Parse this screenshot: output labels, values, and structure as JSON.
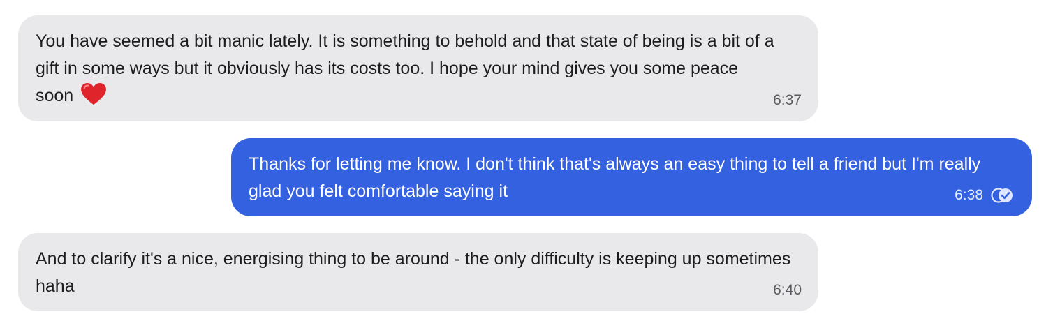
{
  "messages": [
    {
      "direction": "incoming",
      "text": "You have seemed a bit manic lately. It is something to behold and that state of being is a bit of a gift in some ways but it obviously has its costs too. I hope your mind gives you some peace soon",
      "emoji": "heart-emoji",
      "time": "6:37"
    },
    {
      "direction": "outgoing",
      "text": "Thanks for letting me know. I don't think that's always an easy thing to tell a friend but I'm really glad you felt comfortable saying it",
      "time": "6:38",
      "status_icon": "read-receipt-icon"
    },
    {
      "direction": "incoming",
      "text": "And to clarify it's a nice, energising thing to be around - the only difficulty is keeping up sometimes haha",
      "time": "6:40"
    }
  ],
  "colors": {
    "incoming_bubble": "#e9e9eb",
    "outgoing_bubble": "#3461e0",
    "incoming_text": "#1d1d1f",
    "outgoing_text": "#ffffff",
    "heart": "#e0242b"
  }
}
